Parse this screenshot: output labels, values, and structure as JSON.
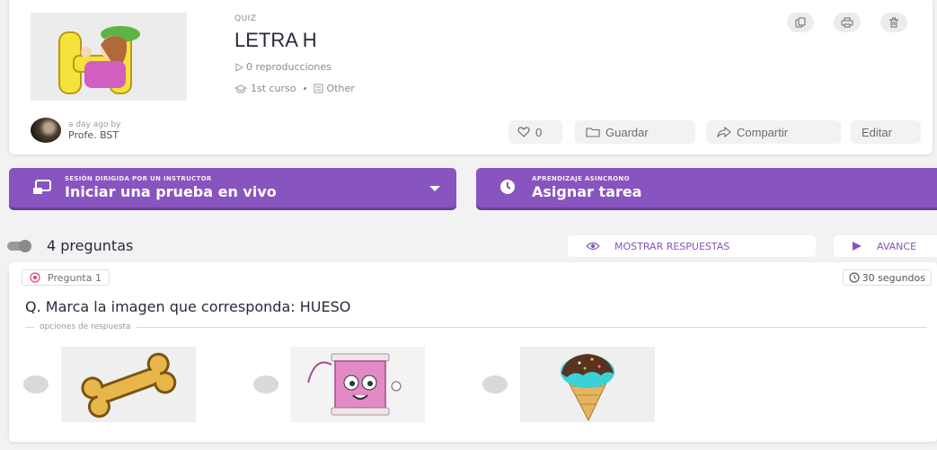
{
  "quiz": {
    "kind": "QUIZ",
    "title": "LETRA H",
    "plays": "0 reproducciones",
    "grade": "1st curso",
    "subject": "Other"
  },
  "author": {
    "ago": "a day ago by",
    "name": "Profe. BST"
  },
  "header_icons": [
    "copy-icon",
    "print-icon",
    "delete-icon"
  ],
  "actions": {
    "like_count": "0",
    "save_label": "Guardar",
    "share_label": "Compartir",
    "edit_label": "Editar"
  },
  "sessions": {
    "live": {
      "sub": "SESIÓN DIRIGIDA POR UN INSTRUCTOR",
      "main": "Iniciar una prueba en vivo"
    },
    "async": {
      "sub": "APRENDIZAJE ASINCRONO",
      "main": "Asignar tarea"
    }
  },
  "questions_bar": {
    "count_label": "4 preguntas",
    "show_answers": "MOSTRAR RESPUESTAS",
    "advance": "AVANCE"
  },
  "question": {
    "tag": "Pregunta 1",
    "time": "30 segundos",
    "text": "Q. Marca la imagen que corresponda: HUESO",
    "options_label": "opciones de respuesta",
    "options": [
      "bone-image",
      "thread-spool-image",
      "ice-cream-image"
    ]
  },
  "colors": {
    "accent": "#8854c0",
    "background": "#f2f2f2",
    "card": "#ffffff"
  }
}
